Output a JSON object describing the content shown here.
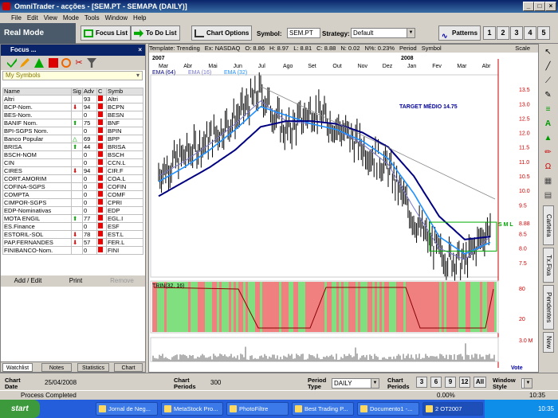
{
  "window": {
    "title": "OmniTrader - acções - [SEM.PT - SEMAPA (DAILY)]"
  },
  "menu": [
    "File",
    "Edit",
    "View",
    "Mode",
    "Tools",
    "Window",
    "Help"
  ],
  "toolbar": {
    "mode": "Real Mode",
    "focus_list": "Focus List",
    "todo_list": "To Do List",
    "chart_options": "Chart Options",
    "symbol_label": "Symbol:",
    "symbol_value": "SEM.PT",
    "strategy_label": "Strategy:",
    "strategy_value": "Default",
    "patterns": "Patterns",
    "nums": [
      "1",
      "2",
      "3",
      "4",
      "5"
    ]
  },
  "focus": {
    "title": "Focus ...",
    "list_name": "My Symbols",
    "columns": [
      "Name",
      "Sig",
      "Adv",
      "C",
      "Symb"
    ],
    "rows": [
      {
        "name": "Altri",
        "sig": "",
        "adv": "93",
        "c": "r",
        "sym": "Altri"
      },
      {
        "name": "BCP-Nom.",
        "sig": "dn",
        "adv": "94",
        "c": "r",
        "sym": "BCPN"
      },
      {
        "name": "BES-Nom.",
        "sig": "",
        "adv": "0",
        "c": "r",
        "sym": "BESN"
      },
      {
        "name": "BANIF Nom.",
        "sig": "up",
        "adv": "75",
        "c": "r",
        "sym": "BNF"
      },
      {
        "name": "BPI-SGPS Nom.",
        "sig": "",
        "adv": "0",
        "c": "r",
        "sym": "BPIN"
      },
      {
        "name": "Banco Popular",
        "sig": "up2",
        "adv": "69",
        "c": "r",
        "sym": "BPP"
      },
      {
        "name": "BRISA",
        "sig": "up",
        "adv": "44",
        "c": "r",
        "sym": "BRISA"
      },
      {
        "name": "BSCH-NOM",
        "sig": "",
        "adv": "0",
        "c": "r",
        "sym": "BSCH"
      },
      {
        "name": "CIN",
        "sig": "",
        "adv": "0",
        "c": "r",
        "sym": "CCN.L"
      },
      {
        "name": "CIRES",
        "sig": "dn",
        "adv": "94",
        "c": "r",
        "sym": "CIR.F"
      },
      {
        "name": "CORT.AMORIM",
        "sig": "",
        "adv": "0",
        "c": "r",
        "sym": "COA.L"
      },
      {
        "name": "COFINA-SGPS",
        "sig": "",
        "adv": "0",
        "c": "r",
        "sym": "COFIN"
      },
      {
        "name": "COMPTA",
        "sig": "",
        "adv": "0",
        "c": "r",
        "sym": "COMF"
      },
      {
        "name": "CIMPOR-SGPS",
        "sig": "",
        "adv": "0",
        "c": "r",
        "sym": "CPRI"
      },
      {
        "name": "EDP-Nominativas",
        "sig": "",
        "adv": "0",
        "c": "r",
        "sym": "EDP"
      },
      {
        "name": "MOTA ENGIL",
        "sig": "up",
        "adv": "77",
        "c": "r",
        "sym": "EGL.I"
      },
      {
        "name": "ES.Finance",
        "sig": "",
        "adv": "0",
        "c": "r",
        "sym": "ESF"
      },
      {
        "name": "ESTORIL-SOL",
        "sig": "dn",
        "adv": "78",
        "c": "r",
        "sym": "EST.L"
      },
      {
        "name": "PAP.FERNANDES",
        "sig": "dn",
        "adv": "57",
        "c": "r",
        "sym": "FER.L"
      },
      {
        "name": "FINIBANCO-Nom.",
        "sig": "",
        "adv": "0",
        "c": "r",
        "sym": "FINI"
      }
    ],
    "buttons": {
      "add": "Add / Edit",
      "print": "Print",
      "remove": "Remove"
    },
    "tabs": [
      "Watchlist",
      "Notes",
      "Statistics",
      "Chart"
    ]
  },
  "chart": {
    "header": {
      "template": "Template: Trending",
      "exchange": "Ex: NASDAQ",
      "o": "O: 8.86",
      "h": "H: 8.97",
      "l": "L: 8.81",
      "c": "C: 8.88",
      "n": "N: 0.02",
      "npct": "N%: 0.23%",
      "period": "Period",
      "symbol": "Symbol",
      "scale": "Scale"
    },
    "year_labels": [
      "2007",
      "2008"
    ],
    "month_labels": [
      "Mar",
      "Abr",
      "Mai",
      "Jun",
      "Jul",
      "Ago",
      "Set",
      "Out",
      "Nov",
      "Dez",
      "Jan",
      "Fev",
      "Mar",
      "Abr"
    ],
    "legend": {
      "ema64": "EMA (64)",
      "ema16": "EMA (16)",
      "ema32": "EMA (32)"
    },
    "annotation": "TARGET MÉDIO 14.75",
    "sml": "S M L",
    "rtr_label": "TRIN(32, 16)",
    "vol_label": "3.0 M",
    "vote_label": "Vote",
    "colors": {
      "price": "#000000",
      "ema64": "#000080",
      "ema16": "#7777cc",
      "ema32": "#1e90ff",
      "bull": "#80e080",
      "bear": "#f08080",
      "axis": "#cc0000"
    }
  },
  "chart_data": {
    "type": "line",
    "title": "SEM.PT - SEMAPA (DAILY)",
    "x": [
      "Mar 2007",
      "Abr",
      "Mai",
      "Jun",
      "Jul",
      "Ago",
      "Set",
      "Out",
      "Nov",
      "Dez",
      "Jan 2008",
      "Fev",
      "Mar",
      "Abr"
    ],
    "series": [
      {
        "name": "price",
        "values": [
          10.6,
          11.2,
          11.8,
          12.5,
          13.4,
          12.0,
          12.8,
          12.2,
          11.5,
          10.8,
          9.0,
          7.8,
          7.5,
          8.8
        ]
      },
      {
        "name": "EMA (16)",
        "values": [
          10.5,
          11.0,
          11.6,
          12.3,
          13.1,
          12.4,
          12.3,
          12.1,
          11.6,
          10.9,
          9.4,
          8.0,
          7.6,
          8.4
        ]
      },
      {
        "name": "EMA (32)",
        "values": [
          10.3,
          10.8,
          11.4,
          12.1,
          12.9,
          12.6,
          12.3,
          12.1,
          11.7,
          11.1,
          9.9,
          8.4,
          7.8,
          8.2
        ]
      },
      {
        "name": "EMA (64)",
        "values": [
          9.8,
          10.3,
          10.8,
          11.4,
          12.2,
          12.4,
          12.4,
          12.3,
          12.0,
          11.5,
          10.5,
          9.1,
          8.3,
          8.4
        ]
      }
    ],
    "ylim": [
      7.0,
      14.0
    ],
    "yticks": [
      "13.5",
      "13.0",
      "12.5",
      "12.0",
      "11.5",
      "11.0",
      "10.5",
      "10.0",
      "9.5",
      "8.88",
      "8.5",
      "8.0",
      "7.5"
    ],
    "trin": {
      "name": "TRIN(32, 16)",
      "ticks": [
        "80",
        "20"
      ]
    }
  },
  "bottom": {
    "chart_date_label": "Chart Date",
    "chart_date": "25/04/2008",
    "chart_periods_label": "Chart Periods",
    "chart_periods": "300",
    "period_type_label": "Period Type",
    "period_type": "DAILY",
    "chart_periods2_label": "Chart Periods",
    "period_btns": [
      "3",
      "6",
      "9",
      "12",
      "All"
    ],
    "window_style_label": "Window Style"
  },
  "status": {
    "text": "Process Completed",
    "pct": "0.00%",
    "time": "10:35"
  },
  "rightbar": {
    "tabs": [
      "Carteira",
      "Tx.Fixa",
      "Pendentes",
      "New"
    ]
  },
  "taskbar": {
    "start": "start",
    "tasks": [
      "Jornal de Neg...",
      "MetaStock Pro...",
      "PhotoFiltre",
      "Best Trading P...",
      "Documento1 -...",
      "OT2007"
    ],
    "tray_time": "10:35",
    "tray_count": "2"
  }
}
